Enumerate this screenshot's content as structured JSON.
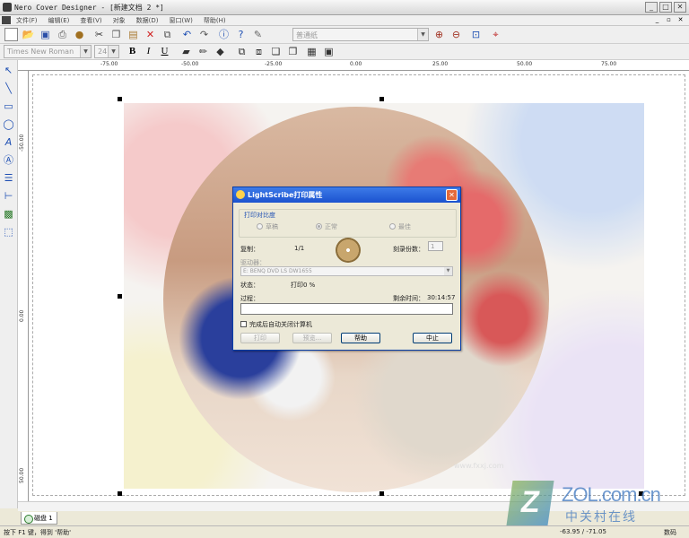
{
  "window": {
    "title": "Nero Cover Designer - [新建文档 2 *]"
  },
  "menu": [
    "文件(F)",
    "编辑(E)",
    "查看(V)",
    "对象",
    "数据(D)",
    "窗口(W)",
    "帮助(H)"
  ],
  "toolbar": {
    "paper_combo": "普通纸"
  },
  "format_toolbar": {
    "font": "Times New Roman",
    "size": "24",
    "bold": "B",
    "italic": "I",
    "underline": "U"
  },
  "ruler": {
    "h_labels": [
      "-75.00",
      "-50.00",
      "-25.00",
      "0.00",
      "25.00",
      "50.00",
      "75.00"
    ],
    "v_labels": [
      "-50.00",
      "0.00",
      "50.00"
    ]
  },
  "dialog": {
    "title": "LightScribe打印属性",
    "contrast_group": "打印对比度",
    "contrast_options": [
      "草稿",
      "正常",
      "最佳"
    ],
    "copy_label": "复制：",
    "copy_value": "1/1",
    "copies_label": "刻录份数：",
    "copies_value": "1",
    "drive_label": "驱动器：",
    "drive_value": "E: BENQ    DVD LS DW1655",
    "status_label": "状态：",
    "status_value": "打印0 %",
    "progress_label": "过程：",
    "remaining_label": "剩余时间：",
    "remaining_value": "30:14:57",
    "progress_percent": 0,
    "auto_shutdown": "完成后自动关闭计算机",
    "btn_print": "打印",
    "btn_preview": "预览...",
    "btn_help": "帮助",
    "btn_abort": "中止"
  },
  "tab": {
    "label": "磁盘 1"
  },
  "status": {
    "hint": "按下 F1 键，得到 '帮助'",
    "coords": "-63.95 / -71.05",
    "mode": "数码"
  },
  "watermark": {
    "z": "Z",
    "line1": "ZOL.com.cn",
    "line2": "中关村在线",
    "url": "www.fxxj.com"
  }
}
